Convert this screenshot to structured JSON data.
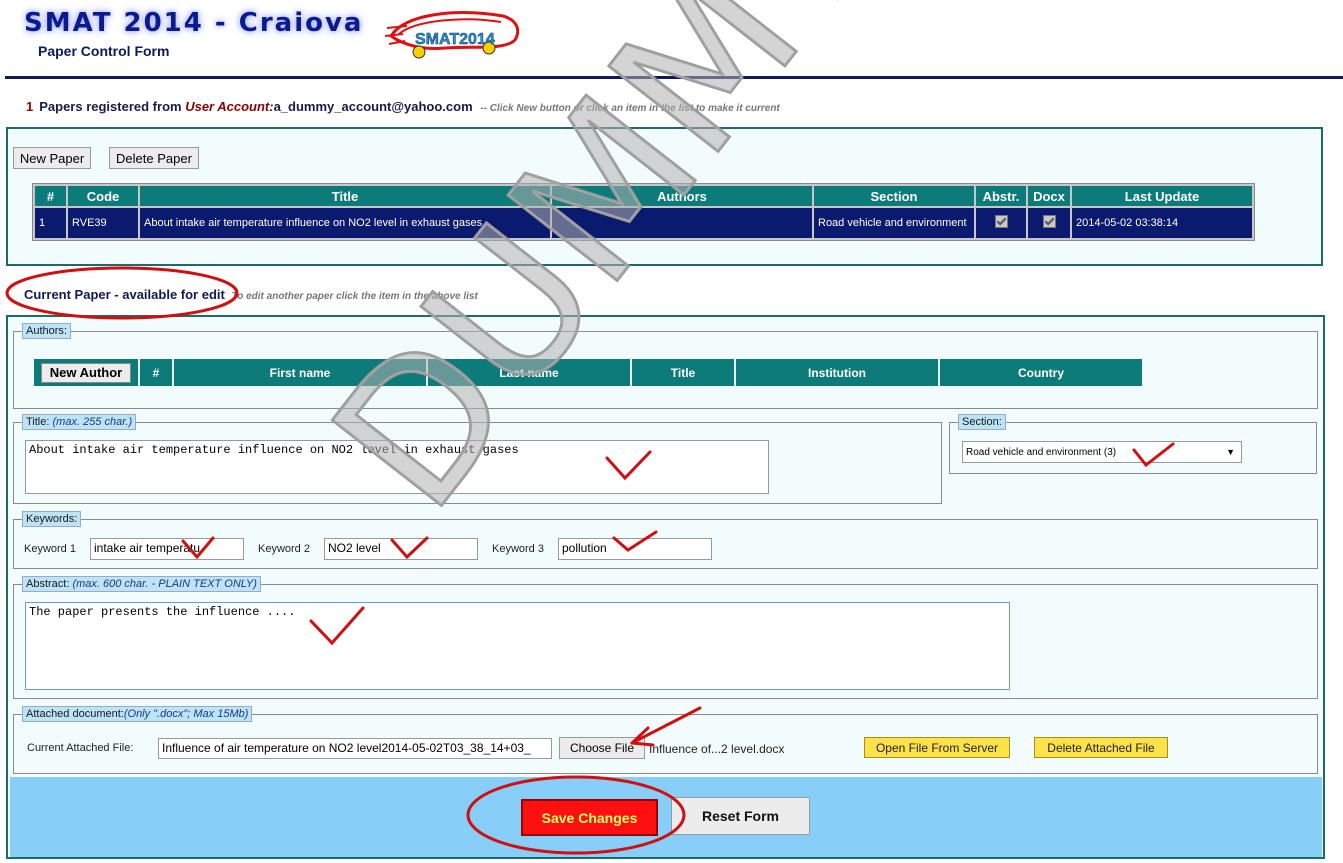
{
  "header": {
    "app_title": "SMAT 2014 - Craiova",
    "subtitle": "Paper Control Form",
    "logo_text": "SMAT2014",
    "colors": {
      "title": "#0b1a8c",
      "rule": "#0f1a5a",
      "table_header": "#0e7b7b",
      "selected_row": "#0a1a6e"
    }
  },
  "registration": {
    "count": "1",
    "text": "Papers registered from",
    "account_label": "User Account:",
    "account": "a_dummy_account@yahoo.com",
    "hint": "-- Click New button or click an item in the list to make it current"
  },
  "papers_panel": {
    "new_paper_label": "New Paper",
    "delete_paper_label": "Delete Paper",
    "columns": [
      "#",
      "Code",
      "Title",
      "Authors",
      "Section",
      "Abstr.",
      "Docx",
      "Last Update"
    ],
    "rows": [
      {
        "num": "1",
        "code": "RVE39",
        "title": "About intake air temperature influence on NO2 level in exhaust gases",
        "authors": "",
        "section": "Road vehicle and environment",
        "abstract_checked": true,
        "docx_checked": true,
        "last_update": "2014-05-02 03:38:14"
      }
    ]
  },
  "current_paper": {
    "label": "Current Paper - available for edit",
    "hint": "To edit another paper click the item in the above list"
  },
  "authors": {
    "legend": "Authors:",
    "new_author_label": "New Author",
    "columns": [
      "#",
      "First name",
      "Last name",
      "Title",
      "Institution",
      "Country"
    ]
  },
  "title_field": {
    "legend": "Title:",
    "legend_note": "(max. 255 char.)",
    "value": "About intake air temperature influence on NO2 level in exhaust gases"
  },
  "section_field": {
    "legend": "Section:",
    "selected": "Road vehicle and environment (3)"
  },
  "keywords": {
    "legend": "Keywords:",
    "k1_label": "Keyword 1",
    "k1_value": "intake air temperatu",
    "k2_label": "Keyword 2",
    "k2_value": "NO2 level",
    "k3_label": "Keyword 3",
    "k3_value": "pollution"
  },
  "abstract": {
    "legend": "Abstract:",
    "legend_note": "(max. 600 char. - PLAIN TEXT ONLY)",
    "value": "The paper presents the influence ...."
  },
  "attachment": {
    "legend": "Attached document:",
    "legend_note": "(Only \".docx\"; Max 15Mb)",
    "current_label": "Current Attached File:",
    "current_value": "Influence of air temperature on NO2 level2014-05-02T03_38_14+03_",
    "choose_file_label": "Choose File",
    "chosen_file": "Influence of...2 level.docx",
    "open_label": "Open File From Server",
    "delete_label": "Delete Attached File"
  },
  "footer": {
    "save_label": "Save Changes",
    "reset_label": "Reset Form"
  },
  "watermark": "DUMMY"
}
